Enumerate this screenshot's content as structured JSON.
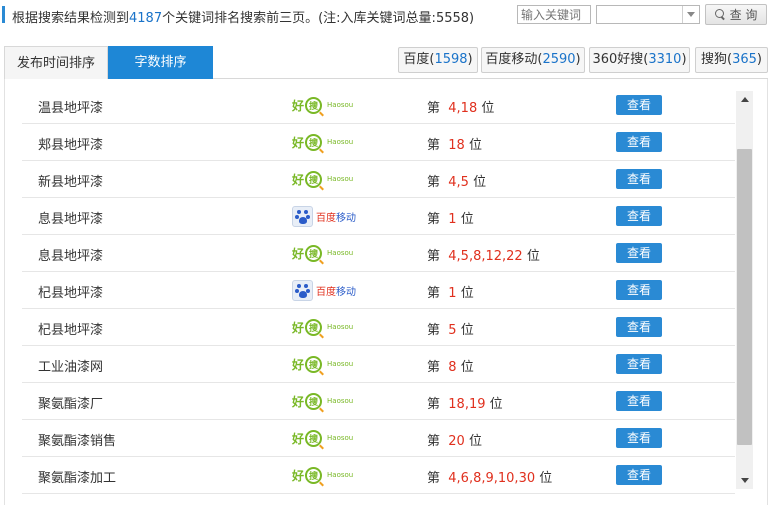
{
  "summary": {
    "prefix": "根据搜索结果检测到",
    "count": "4187",
    "suffix": "个关键词排名搜索前三页。(注:入库关键词总量:5558)"
  },
  "search": {
    "placeholder": "输入关键词",
    "select_value": "",
    "button_label": "查 询"
  },
  "sort_tabs": [
    {
      "label": "发布时间排序",
      "active": false
    },
    {
      "label": "字数排序",
      "active": true
    }
  ],
  "engines": [
    {
      "name": "百度",
      "count": "1598"
    },
    {
      "name": "百度移动",
      "count": "2590"
    },
    {
      "name": "360好搜",
      "count": "3310"
    },
    {
      "name": "搜狗",
      "count": "365"
    }
  ],
  "rank_prefix": "第",
  "rank_suffix": "位",
  "view_label": "查看",
  "logos": {
    "haosou": {
      "hao": "好",
      "sou": "搜",
      "latin": "Haosou",
      "color": "#79b826"
    },
    "baidu": {
      "a": "百度",
      "b": "移动",
      "color": "#2b5cc9"
    }
  },
  "rows": [
    {
      "keyword": "温县地坪漆",
      "engine": "haosou",
      "positions": "4,18"
    },
    {
      "keyword": "郏县地坪漆",
      "engine": "haosou",
      "positions": "18"
    },
    {
      "keyword": "新县地坪漆",
      "engine": "haosou",
      "positions": "4,5"
    },
    {
      "keyword": "息县地坪漆",
      "engine": "baidu",
      "positions": "1"
    },
    {
      "keyword": "息县地坪漆",
      "engine": "haosou",
      "positions": "4,5,8,12,22"
    },
    {
      "keyword": "杞县地坪漆",
      "engine": "baidu",
      "positions": "1"
    },
    {
      "keyword": "杞县地坪漆",
      "engine": "haosou",
      "positions": "5"
    },
    {
      "keyword": "工业油漆网",
      "engine": "haosou",
      "positions": "8"
    },
    {
      "keyword": "聚氨酯漆厂",
      "engine": "haosou",
      "positions": "18,19"
    },
    {
      "keyword": "聚氨酯漆销售",
      "engine": "haosou",
      "positions": "20"
    },
    {
      "keyword": "聚氨酯漆加工",
      "engine": "haosou",
      "positions": "4,6,8,9,10,30"
    }
  ]
}
